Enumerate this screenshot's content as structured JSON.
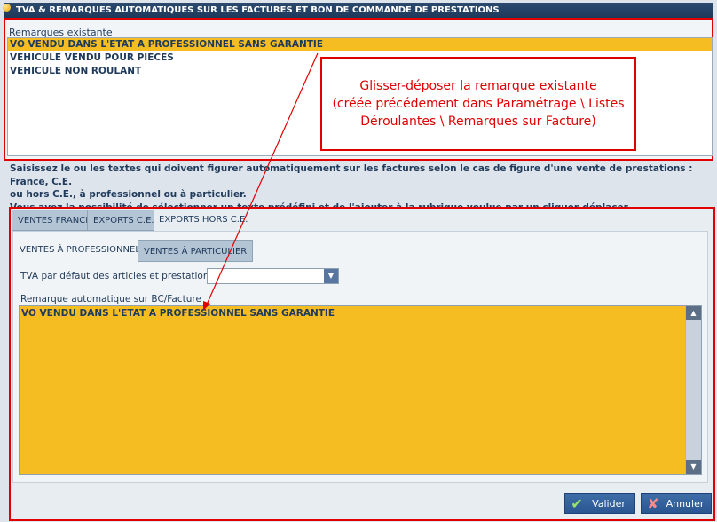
{
  "title": "TVA & REMARQUES AUTOMATIQUES SUR LES FACTURES ET BON DE COMMANDE DE PRESTATIONS",
  "existing": {
    "label": "Remarques existante",
    "items": [
      "VO VENDU DANS L'ETAT A PROFESSIONNEL SANS GARANTIE",
      "VEHICULE VENDU POUR PIECES",
      "VEHICULE NON ROULANT"
    ],
    "selected_index": 0
  },
  "callout": {
    "line1": "Glisser-déposer la remarque existante",
    "line2": "(créée précédement dans Paramétrage \\ Listes",
    "line3": "Déroulantes \\ Remarques sur Facture)"
  },
  "instructions": {
    "line1": "Saisissez le ou les textes qui doivent figurer automatiquement sur les factures selon le cas de figure d'une vente de prestations : France, C.E.",
    "line2": "ou hors C.E., à professionnel ou à particulier.",
    "line3": "Vous avez la possibilité de sélectionner un texte prédéfini et de l'ajouter à la rubrique voulue par un cliquer-déplacer."
  },
  "tabs": [
    {
      "label": "VENTES FRANCE",
      "active": false
    },
    {
      "label": "EXPORTS C.E.",
      "active": false
    },
    {
      "label": "EXPORTS HORS C.E.",
      "active": true
    }
  ],
  "subtabs": [
    {
      "label": "VENTES À PROFESSIONNEL",
      "active": true
    },
    {
      "label": "VENTES À PARTICULIER",
      "active": false
    }
  ],
  "tva": {
    "label": "TVA par défaut des articles et prestations",
    "value": ""
  },
  "remark": {
    "label": "Remarque automatique sur BC/Facture",
    "value": "VO VENDU DANS L'ETAT A PROFESSIONNEL SANS GARANTIE"
  },
  "buttons": {
    "validate": "Valider",
    "cancel": "Annuler"
  },
  "colors": {
    "highlight": "#f5bd22",
    "annotation_red": "#e00000",
    "title_bar": "#1d3a5c",
    "button_blue": "#2f5d9a"
  },
  "icons": [
    "status-dot-icon",
    "chevron-down-icon",
    "scroll-up-icon",
    "scroll-down-icon",
    "checkmark-icon",
    "cross-icon"
  ]
}
